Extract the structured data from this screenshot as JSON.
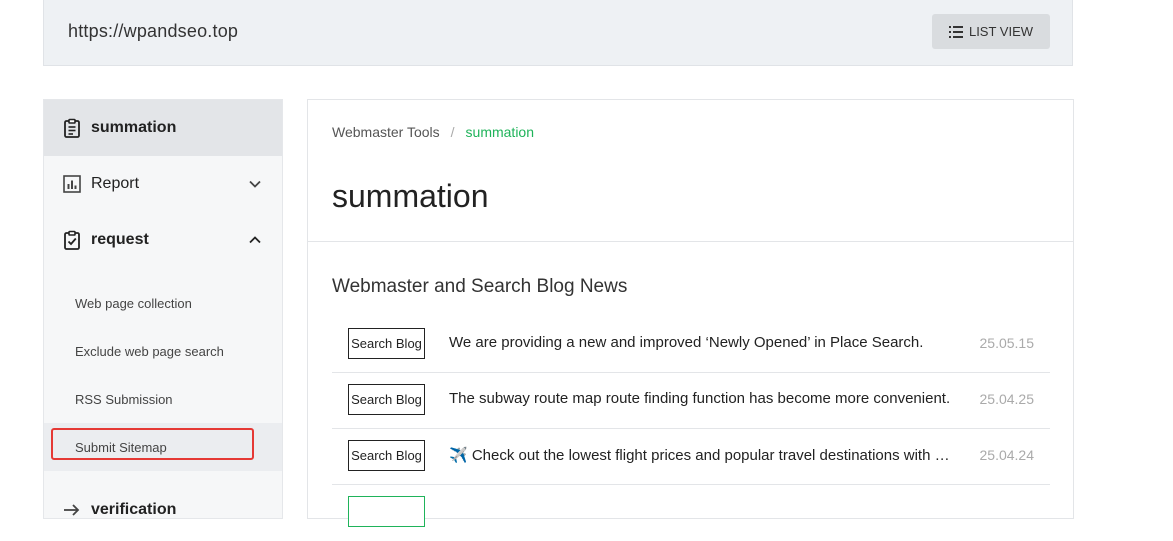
{
  "header": {
    "site_url": "https://wpandseo.top",
    "list_view_label": "LIST VIEW"
  },
  "sidebar": {
    "items": [
      {
        "label": "summation",
        "icon": "clipboard-icon",
        "active": true
      },
      {
        "label": "Report",
        "icon": "bar-chart-icon",
        "expanded": false
      },
      {
        "label": "request",
        "icon": "clipboard-check-icon",
        "expanded": true
      },
      {
        "label": "verification",
        "icon": "arrow-right-icon"
      }
    ],
    "request_subitems": [
      "Web page collection",
      "Exclude web page search",
      "RSS Submission",
      "Submit Sitemap"
    ]
  },
  "main": {
    "breadcrumb": {
      "root": "Webmaster Tools",
      "separator": "/",
      "current": "summation"
    },
    "title": "summation",
    "section_title": "Webmaster and Search Blog News",
    "news": [
      {
        "badge": "Search Blog",
        "title": "We are providing a new and improved ‘Newly Opened’ in Place Search.",
        "date": "25.05.15"
      },
      {
        "badge": "Search Blog",
        "title": "The subway route map route finding function has become more convenient.",
        "date": "25.04.25"
      },
      {
        "badge": "Search Blog",
        "title": "✈️ Check out the lowest flight prices and popular travel destinations with Search.",
        "date": "25.04.24"
      },
      {
        "badge": "",
        "title": "",
        "date": ""
      }
    ]
  },
  "colors": {
    "accent_green": "#1fb35a",
    "highlight_red": "#e53935"
  }
}
